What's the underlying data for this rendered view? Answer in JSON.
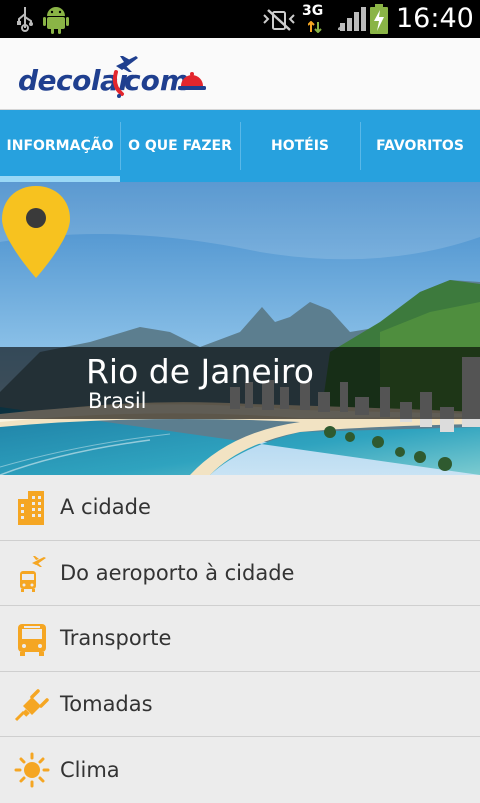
{
  "status_bar": {
    "network": "3G",
    "time": "16:40"
  },
  "header": {
    "logo_part1": "decolar",
    "logo_part2": "com"
  },
  "tabs": [
    {
      "label": "INFORMAÇÃO",
      "active": true
    },
    {
      "label": "O QUE FAZER",
      "active": false
    },
    {
      "label": "HOTÉIS",
      "active": false
    },
    {
      "label": "FAVORITOS",
      "active": false
    }
  ],
  "destination": {
    "city": "Rio de Janeiro",
    "country": "Brasil"
  },
  "menu": [
    {
      "label": "A cidade",
      "icon": "building-icon"
    },
    {
      "label": "Do aeroporto à cidade",
      "icon": "airport-bus-icon"
    },
    {
      "label": "Transporte",
      "icon": "bus-icon"
    },
    {
      "label": "Tomadas",
      "icon": "plug-icon"
    },
    {
      "label": "Clima",
      "icon": "sun-icon"
    }
  ],
  "colors": {
    "tab_bar": "#27a1de",
    "active_tab_indicator": "#9ad8f6",
    "logo_blue": "#1f3f8f",
    "logo_red": "#e3262d",
    "icon_orange": "#f5a623",
    "pin_yellow": "#f7c21f"
  }
}
